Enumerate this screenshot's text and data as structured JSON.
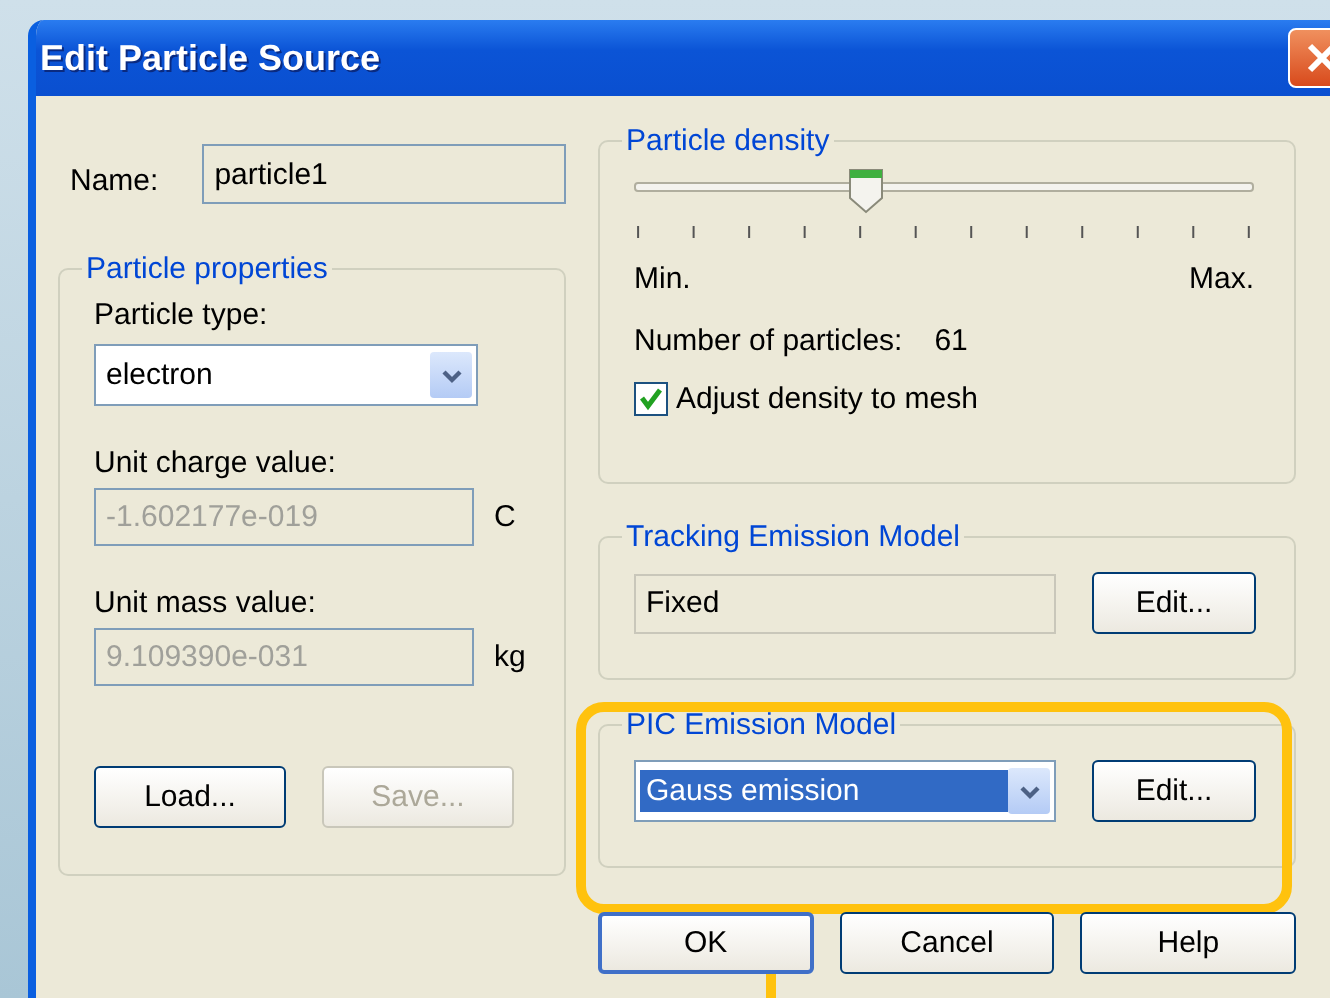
{
  "window": {
    "title": "Edit Particle Source"
  },
  "name": {
    "label": "Name:",
    "value": "particle1"
  },
  "particle_properties": {
    "title": "Particle properties",
    "type_label": "Particle type:",
    "type_value": "electron",
    "charge": {
      "label": "Unit charge value:",
      "value": "-1.602177e-019",
      "unit": "C",
      "disabled": true
    },
    "mass": {
      "label": "Unit mass value:",
      "value": "9.109390e-031",
      "unit": "kg",
      "disabled": true
    },
    "buttons": [
      {
        "label": "Load...",
        "disabled": false
      },
      {
        "label": "Save...",
        "disabled": true
      }
    ]
  },
  "particle_density": {
    "title": "Particle density",
    "level": 0.375,
    "min_label": "Min.",
    "max_label": "Max.",
    "count_label": "Number of particles:",
    "count": "61",
    "adjust": {
      "label": "Adjust density to mesh",
      "checked": true
    }
  },
  "tracking_emission": {
    "title": "Tracking Emission Model",
    "value": "Fixed",
    "button": "Edit..."
  },
  "pic_emission": {
    "title": "PIC Emission Model",
    "value": "Gauss emission",
    "selected": true,
    "highlighted": true,
    "button": "Edit..."
  },
  "buttons": [
    {
      "label": "OK",
      "default": true
    },
    {
      "label": "Cancel",
      "default": false
    },
    {
      "label": "Help",
      "default": false
    }
  ]
}
